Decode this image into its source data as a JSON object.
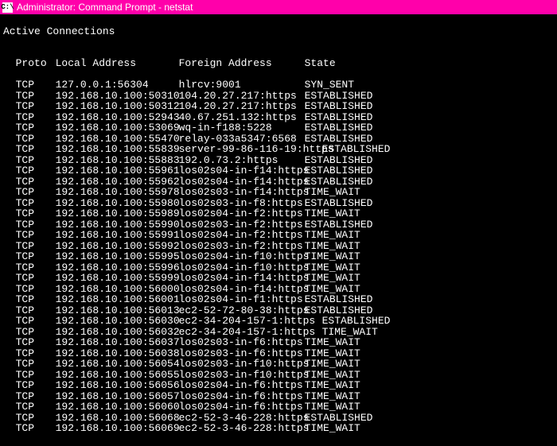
{
  "window": {
    "title": "Administrator: Command Prompt - netstat",
    "sys_icon_label": "C:\\"
  },
  "heading": "Active Connections",
  "columns": {
    "proto": "Proto",
    "local": "Local Address",
    "foreign": "Foreign Address",
    "state": "State"
  },
  "rows": [
    {
      "proto": "TCP",
      "local": "127.0.0.1:56304",
      "foreign": "hlrcv:9001",
      "state": "SYN_SENT"
    },
    {
      "proto": "TCP",
      "local": "192.168.10.100:50310",
      "foreign": "104.20.27.217:https",
      "state": "ESTABLISHED"
    },
    {
      "proto": "TCP",
      "local": "192.168.10.100:50312",
      "foreign": "104.20.27.217:https",
      "state": "ESTABLISHED"
    },
    {
      "proto": "TCP",
      "local": "192.168.10.100:52943",
      "foreign": "40.67.251.132:https",
      "state": "ESTABLISHED"
    },
    {
      "proto": "TCP",
      "local": "192.168.10.100:53069",
      "foreign": "wq-in-f188:5228",
      "state": "ESTABLISHED"
    },
    {
      "proto": "TCP",
      "local": "192.168.10.100:55470",
      "foreign": "relay-033a5347:6568",
      "state": "ESTABLISHED"
    },
    {
      "proto": "TCP",
      "local": "192.168.10.100:55839",
      "foreign": "server-99-86-116-19:https",
      "state": "ESTABLISHED",
      "wide": true
    },
    {
      "proto": "TCP",
      "local": "192.168.10.100:55883",
      "foreign": "192.0.73.2:https",
      "state": "ESTABLISHED"
    },
    {
      "proto": "TCP",
      "local": "192.168.10.100:55961",
      "foreign": "los02s04-in-f14:https",
      "state": "ESTABLISHED"
    },
    {
      "proto": "TCP",
      "local": "192.168.10.100:55962",
      "foreign": "los02s04-in-f14:https",
      "state": "ESTABLISHED"
    },
    {
      "proto": "TCP",
      "local": "192.168.10.100:55978",
      "foreign": "los02s03-in-f14:https",
      "state": "TIME_WAIT"
    },
    {
      "proto": "TCP",
      "local": "192.168.10.100:55980",
      "foreign": "los02s03-in-f8:https",
      "state": "ESTABLISHED"
    },
    {
      "proto": "TCP",
      "local": "192.168.10.100:55989",
      "foreign": "los02s04-in-f2:https",
      "state": "TIME_WAIT"
    },
    {
      "proto": "TCP",
      "local": "192.168.10.100:55990",
      "foreign": "los02s03-in-f2:https",
      "state": "ESTABLISHED"
    },
    {
      "proto": "TCP",
      "local": "192.168.10.100:55991",
      "foreign": "los02s04-in-f2:https",
      "state": "TIME_WAIT"
    },
    {
      "proto": "TCP",
      "local": "192.168.10.100:55992",
      "foreign": "los02s03-in-f2:https",
      "state": "TIME_WAIT"
    },
    {
      "proto": "TCP",
      "local": "192.168.10.100:55995",
      "foreign": "los02s04-in-f10:https",
      "state": "TIME_WAIT"
    },
    {
      "proto": "TCP",
      "local": "192.168.10.100:55996",
      "foreign": "los02s04-in-f10:https",
      "state": "TIME_WAIT"
    },
    {
      "proto": "TCP",
      "local": "192.168.10.100:55999",
      "foreign": "los02s04-in-f14:https",
      "state": "TIME_WAIT"
    },
    {
      "proto": "TCP",
      "local": "192.168.10.100:56000",
      "foreign": "los02s04-in-f14:https",
      "state": "TIME_WAIT"
    },
    {
      "proto": "TCP",
      "local": "192.168.10.100:56001",
      "foreign": "los02s04-in-f1:https",
      "state": "ESTABLISHED"
    },
    {
      "proto": "TCP",
      "local": "192.168.10.100:56013",
      "foreign": "ec2-52-72-80-38:https",
      "state": "ESTABLISHED"
    },
    {
      "proto": "TCP",
      "local": "192.168.10.100:56030",
      "foreign": "ec2-34-204-157-1:https",
      "state": "ESTABLISHED",
      "wide": true
    },
    {
      "proto": "TCP",
      "local": "192.168.10.100:56032",
      "foreign": "ec2-34-204-157-1:https",
      "state": "TIME_WAIT",
      "wide": true
    },
    {
      "proto": "TCP",
      "local": "192.168.10.100:56037",
      "foreign": "los02s03-in-f6:https",
      "state": "TIME_WAIT"
    },
    {
      "proto": "TCP",
      "local": "192.168.10.100:56038",
      "foreign": "los02s03-in-f6:https",
      "state": "TIME_WAIT"
    },
    {
      "proto": "TCP",
      "local": "192.168.10.100:56054",
      "foreign": "los02s03-in-f10:https",
      "state": "TIME_WAIT"
    },
    {
      "proto": "TCP",
      "local": "192.168.10.100:56055",
      "foreign": "los02s03-in-f10:https",
      "state": "TIME_WAIT"
    },
    {
      "proto": "TCP",
      "local": "192.168.10.100:56056",
      "foreign": "los02s04-in-f6:https",
      "state": "TIME_WAIT"
    },
    {
      "proto": "TCP",
      "local": "192.168.10.100:56057",
      "foreign": "los02s04-in-f6:https",
      "state": "TIME_WAIT"
    },
    {
      "proto": "TCP",
      "local": "192.168.10.100:56060",
      "foreign": "los02s04-in-f6:https",
      "state": "TIME_WAIT"
    },
    {
      "proto": "TCP",
      "local": "192.168.10.100:56068",
      "foreign": "ec2-52-3-46-228:https",
      "state": "ESTABLISHED"
    },
    {
      "proto": "TCP",
      "local": "192.168.10.100:56069",
      "foreign": "ec2-52-3-46-228:https",
      "state": "TIME_WAIT"
    }
  ]
}
